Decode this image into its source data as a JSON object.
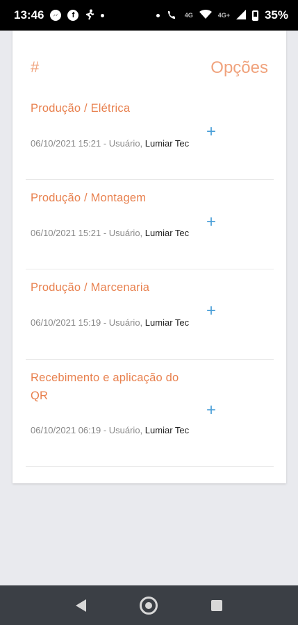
{
  "status_bar": {
    "time": "13:46",
    "network_badge": "4G",
    "signal_badge": "4G+",
    "battery": "35%",
    "icons": [
      "messenger-icon",
      "facebook-icon",
      "running-icon",
      "dot-icon",
      "dot-icon",
      "wifi-calling-icon",
      "wifi-icon",
      "signal-icon",
      "battery-icon"
    ]
  },
  "table": {
    "header_number": "#",
    "header_options": "Opções",
    "rows": [
      {
        "title": "Produção / Elétrica",
        "meta_prefix": "06/10/2021 15:21 - Usuário, ",
        "meta_user": "Lumiar Tec",
        "action": "+"
      },
      {
        "title": "Produção / Montagem",
        "meta_prefix": "06/10/2021 15:21 - Usuário, ",
        "meta_user": "Lumiar Tec",
        "action": "+"
      },
      {
        "title": "Produção / Marcenaria",
        "meta_prefix": "06/10/2021 15:19 - Usuário, ",
        "meta_user": "Lumiar Tec",
        "action": "+"
      },
      {
        "title": "Recebimento e aplicação do QR",
        "meta_prefix": "06/10/2021 06:19 - Usuário, ",
        "meta_user": "Lumiar Tec",
        "action": "+"
      }
    ]
  },
  "colors": {
    "accent": "#e8804e",
    "header": "#f0a27c",
    "action": "#4a9fd8",
    "background": "#e9eaee",
    "nav_bar": "#3b3f45"
  }
}
